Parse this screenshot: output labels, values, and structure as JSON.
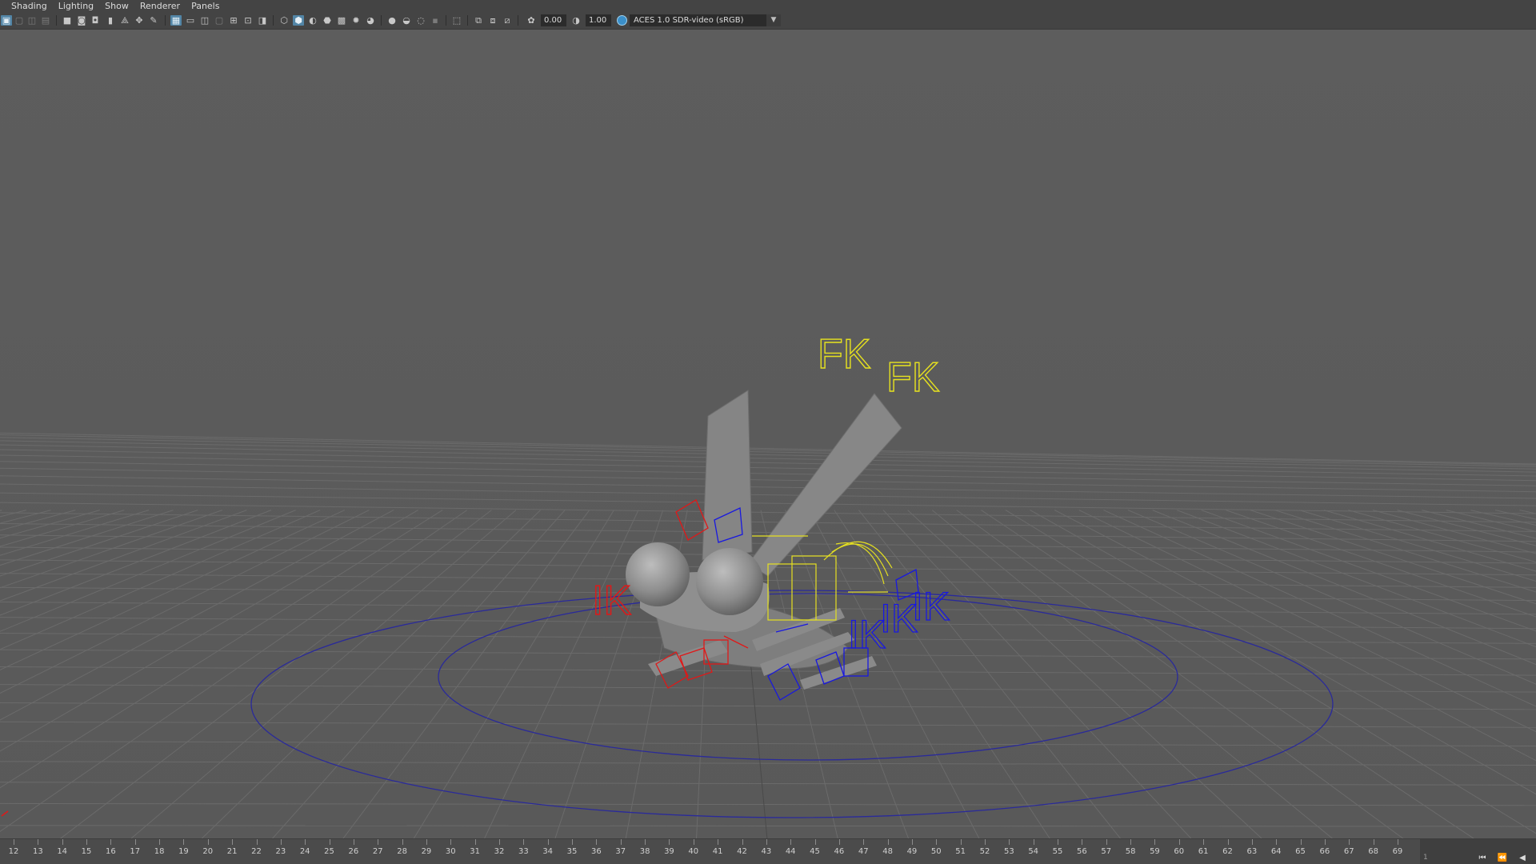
{
  "menubar": {
    "items": [
      "Shading",
      "Lighting",
      "Show",
      "Renderer",
      "Panels"
    ]
  },
  "toolbar": {
    "exposure_value": "0.00",
    "gamma_value": "1.00",
    "color_space": "ACES 1.0 SDR-video (sRGB)",
    "icons": [
      "select-camera-icon",
      "camera-attributes-icon",
      "bookmark-icon",
      "image-plane-icon",
      "grid-icon",
      "film-gate-icon",
      "resolution-gate-icon",
      "wireframe-icon",
      "smooth-shade-icon",
      "textured-icon",
      "lights-icon",
      "shadows-icon",
      "isolate-icon",
      "xray-icon",
      "exposure-icon",
      "gamma-icon",
      "color-management-icon"
    ]
  },
  "viewport": {
    "labels": {
      "fk_1": "FK",
      "fk_2": "FK",
      "ik_left": "IK",
      "ik_right_1": "IK",
      "ik_right_2": "IK",
      "ik_right_3": "IK"
    },
    "colors": {
      "background": "#5a5a5a",
      "grid_line": "#6a6a6a",
      "grid_axis": "#4a4a4a",
      "mesh": "#8a8a8a",
      "control_yellow": "#e5e020",
      "control_red": "#e01818",
      "control_blue": "#1818e0",
      "root_circle": "#2a2a9a"
    }
  },
  "timeline": {
    "frames": [
      "12",
      "13",
      "14",
      "15",
      "16",
      "17",
      "18",
      "19",
      "20",
      "21",
      "22",
      "23",
      "24",
      "25",
      "26",
      "27",
      "28",
      "29",
      "30",
      "31",
      "32",
      "33",
      "34",
      "35",
      "36",
      "37",
      "38",
      "39",
      "40",
      "41",
      "42",
      "43",
      "44",
      "45",
      "46",
      "47",
      "48",
      "49",
      "50",
      "51",
      "52",
      "53",
      "54",
      "55",
      "56",
      "57",
      "58",
      "59",
      "60",
      "61",
      "62",
      "63",
      "64",
      "65",
      "66",
      "67",
      "68",
      "69"
    ],
    "current_frame_field": "1",
    "buttons": [
      "go-to-start-icon",
      "step-back-icon",
      "play-back-icon"
    ]
  }
}
